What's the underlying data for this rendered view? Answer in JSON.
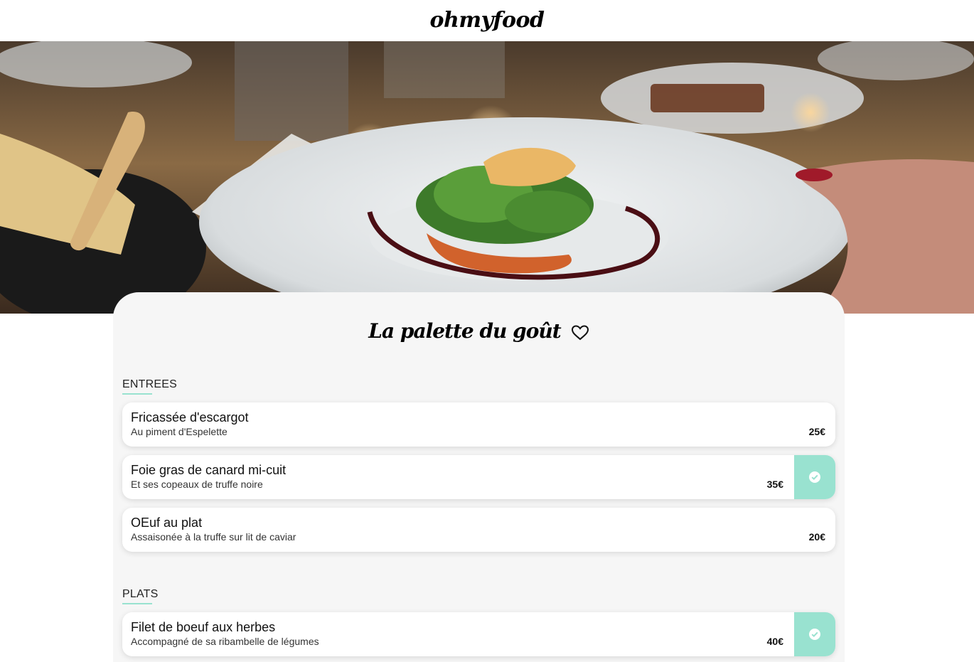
{
  "header": {
    "logo": "ohmyfood"
  },
  "hero": {
    "icon": "plated-dish-photo"
  },
  "restaurant": {
    "name": "La palette du goût",
    "favorite_icon": "heart-outline-icon"
  },
  "colors": {
    "accent": "#99e2d0",
    "sheet_bg": "#f6f6f6"
  },
  "sections": [
    {
      "label": "ENTREES",
      "items": [
        {
          "name": "Fricassée d'escargot",
          "description": "Au piment d'Espelette",
          "price": "25€",
          "selected": false
        },
        {
          "name": "Foie gras de canard mi-cuit",
          "description": "Et ses copeaux de truffe noire",
          "price": "35€",
          "selected": true
        },
        {
          "name": "OEuf au plat",
          "description": "Assaisonée à la truffe sur lit de caviar",
          "price": "20€",
          "selected": false
        }
      ]
    },
    {
      "label": "PLATS",
      "items": [
        {
          "name": "Filet de boeuf aux herbes",
          "description": "Accompagné de sa ribambelle de légumes",
          "price": "40€",
          "selected": true
        }
      ]
    }
  ]
}
